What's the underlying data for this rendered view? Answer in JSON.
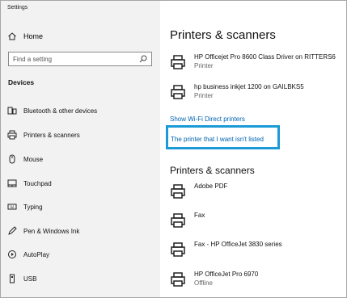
{
  "window": {
    "title": "Settings"
  },
  "sidebar": {
    "home_label": "Home",
    "search_placeholder": "Find a setting",
    "section_label": "Devices",
    "items": [
      {
        "label": "Bluetooth & other devices",
        "icon": "bluetooth-devices-icon"
      },
      {
        "label": "Printers & scanners",
        "icon": "printer-icon"
      },
      {
        "label": "Mouse",
        "icon": "mouse-icon"
      },
      {
        "label": "Touchpad",
        "icon": "touchpad-icon"
      },
      {
        "label": "Typing",
        "icon": "keyboard-icon"
      },
      {
        "label": "Pen & Windows Ink",
        "icon": "pen-icon"
      },
      {
        "label": "AutoPlay",
        "icon": "autoplay-icon"
      },
      {
        "label": "USB",
        "icon": "usb-icon"
      }
    ]
  },
  "main": {
    "title": "Printers & scanners",
    "top_devices": [
      {
        "name": "HP Officejet Pro 8600 Class Driver on RITTERS6",
        "status": "Printer"
      },
      {
        "name": "hp business inkjet 1200 on GAILBKS5",
        "status": "Printer"
      }
    ],
    "wifi_direct_link": "Show Wi-Fi Direct printers",
    "not_listed_link": "The printer that I want isn't listed",
    "subtitle": "Printers & scanners",
    "devices": [
      {
        "name": "Adobe PDF",
        "status": ""
      },
      {
        "name": "Fax",
        "status": ""
      },
      {
        "name": "Fax - HP OfficeJet 3830 series",
        "status": ""
      },
      {
        "name": "HP OfficeJet Pro 6970",
        "status": "Offline"
      }
    ]
  },
  "colors": {
    "sidebar_bg": "#f2f2f2",
    "link": "#0063b1",
    "highlight": "#1a9ad6"
  }
}
